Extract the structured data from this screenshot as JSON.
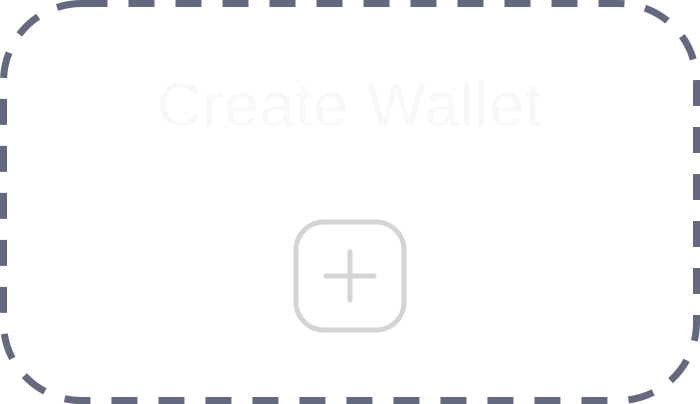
{
  "card": {
    "title": "Create Wallet",
    "icon": "add-square-icon"
  },
  "colors": {
    "border": "#636a80",
    "title": "#f7f8fa",
    "icon": "#d4d4d4",
    "background": "#ffffff"
  }
}
